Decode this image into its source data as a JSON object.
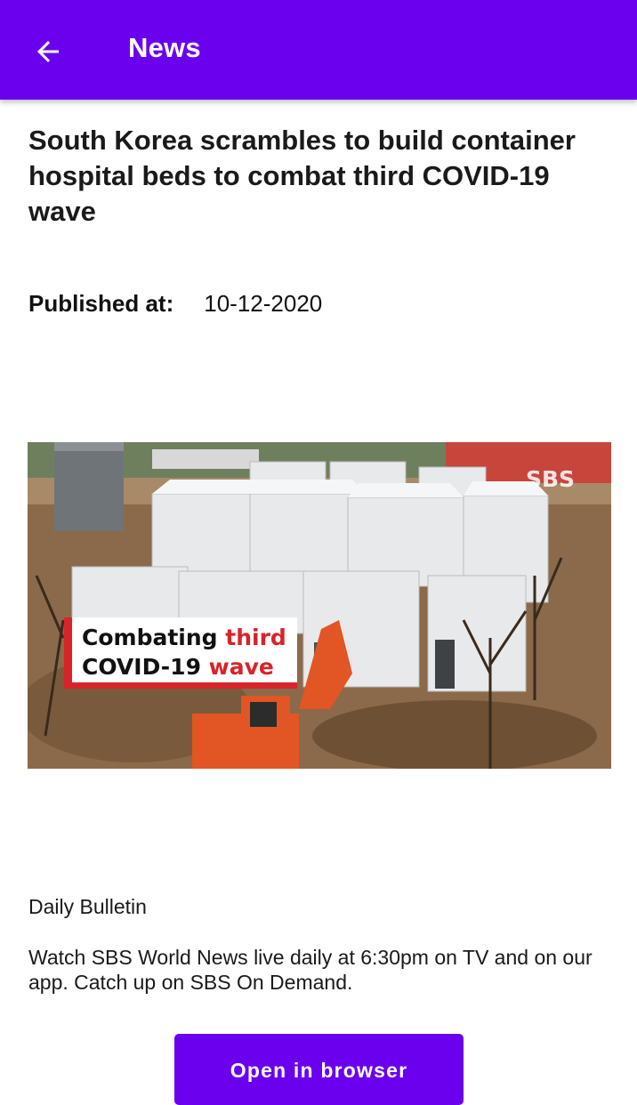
{
  "appbar": {
    "title": "News",
    "back_icon": "arrow-left-icon",
    "color": "#6a00ee"
  },
  "article": {
    "headline": "South Korea scrambles to build container hospital beds to combat third COVID-19 wave",
    "published_label": "Published at:",
    "published_date": "10-12-2020",
    "image": {
      "caption_part1": "Combating ",
      "caption_highlight1": "third",
      "caption_part2": "COVID-19 ",
      "caption_highlight2": "wave",
      "watermark": "SBS"
    },
    "source": "Daily Bulletin",
    "description": "Watch SBS World News live daily at 6:30pm on TV and on our app. Catch up on SBS On Demand."
  },
  "actions": {
    "open_browser_label": "Open in browser"
  }
}
